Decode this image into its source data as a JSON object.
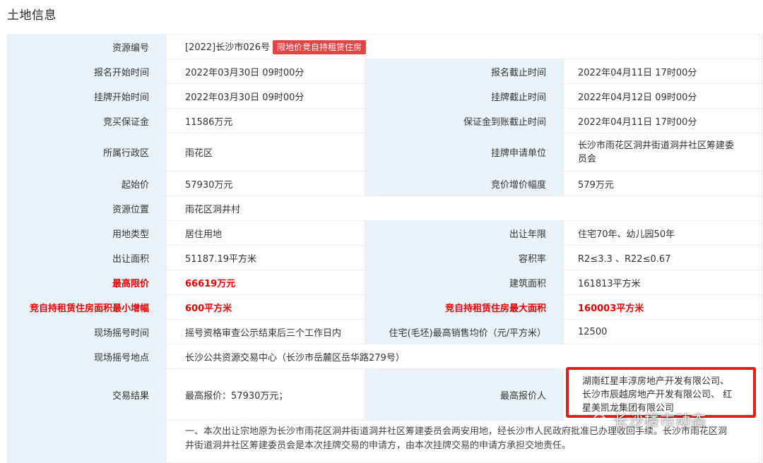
{
  "page_title": "土地信息",
  "rows": [
    {
      "l1": "资源编号",
      "v1": "[2022]长沙市026号",
      "tag": "限地价竞自持租赁住房"
    },
    {
      "l1": "报名开始时间",
      "v1": "2022年03月30日 09时00分",
      "l2": "报名截止时间",
      "v2": "2022年04月11日 17时00分"
    },
    {
      "l1": "挂牌开始时间",
      "v1": "2022年03月30日 09时00分",
      "l2": "挂牌截止时间",
      "v2": "2022年04月12日 09时00分"
    },
    {
      "l1": "竞买保证金",
      "v1": "11586万元",
      "l2": "保证金到账截止时间",
      "v2": "2022年04月11日 17时00分"
    },
    {
      "l1": "所属行政区",
      "v1": "雨花区",
      "l2": "挂牌申请单位",
      "v2a": "长沙市雨花区洞井街道洞井社区筹建委",
      "v2b": "员会"
    },
    {
      "l1": "起始价",
      "v1": "57930万元",
      "l2": "竞价增价幅度",
      "v2": "579万元"
    },
    {
      "l1": "资源位置",
      "v1": "雨花区洞井村"
    },
    {
      "l1": "用地类型",
      "v1": "居住用地",
      "l2": "出让年限",
      "v2": "住宅70年、幼儿园50年"
    },
    {
      "l1": "出让面积",
      "v1": "51187.19平方米",
      "l2": "容积率",
      "v2": "R2≤3.3 、R22≤0.67"
    },
    {
      "l1": "最高限价",
      "v1": "66619万元",
      "l2": "建筑面积",
      "v2": "161813平方米"
    },
    {
      "l1": "竞自持租赁住房面积最小增幅",
      "v1": "600平方米",
      "l2": "竞自持租赁住房最大面积",
      "v2": "160003平方米"
    },
    {
      "l1": "现场摇号时间",
      "v1": "摇号资格审查公示结束后三个工作日内",
      "l2": "住宅(毛坯)最高销售均价（元/平方米）",
      "v2": "12500"
    },
    {
      "l1": "现场摇号地点",
      "v1": "长沙公共资源交易中心（长沙市岳麓区岳华路279号）"
    },
    {
      "l1": "交易结果",
      "v1": "最高报价：57930万元；",
      "l2": "最高报价人",
      "v2a": "湖南红星丰淳房地产开发有限公司、",
      "v2b": "长沙市辰越房地产开发有限公司、 红",
      "v2c": "星美凯龙集团有限公司"
    }
  ],
  "note_line1": "一、本次出让宗地原为长沙市雨花区洞井街道洞井社区筹建委员会两安用地，经长沙市人民政府批准已办理收回手续。长沙市雨花区洞",
  "note_line2": "井街道洞井社区筹建委员会是本次挂牌交易的申请方，由本次挂牌交易的申请方承担交地责任。",
  "watermark": "长沙楼市动态",
  "colors": {
    "label_bg": "#e9f4fa",
    "accent_red": "#ee0000",
    "tag_red": "#e54444",
    "highlight_border": "#e81c1c"
  },
  "icons": {
    "watermark": "wechat-icon"
  }
}
